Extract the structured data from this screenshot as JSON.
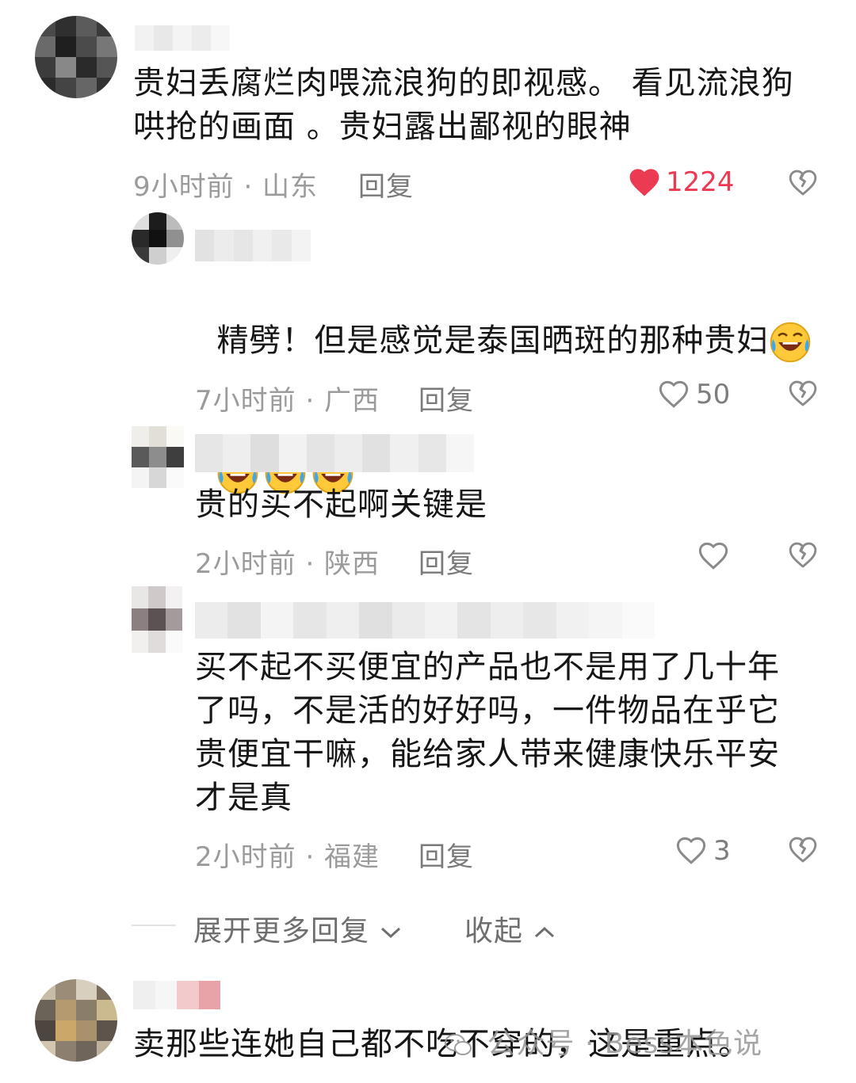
{
  "comments": [
    {
      "text": "贵妇丢腐烂肉喂流浪狗的即视感。 看见流浪狗\n哄抢的画面 。贵妇露出鄙视的眼神",
      "meta": "9小时前 · 山东",
      "reply_label": "回复",
      "likes": "1224",
      "liked": true
    },
    {
      "text": "精劈！但是感觉是泰国晒斑的那种贵妇",
      "emoji_name": "laughing-tears-emoji",
      "meta": "7小时前 · 广西",
      "reply_label": "回复",
      "likes": "50"
    },
    {
      "text": "贵的买不起啊关键是",
      "meta": "2小时前 · 陕西",
      "reply_label": "回复",
      "likes": ""
    },
    {
      "text": "买不起不买便宜的产品也不是用了几十年\n了吗，不是活的好好吗，一件物品在乎它\n贵便宜干嘛，能给家人带来健康快乐平安\n才是真",
      "meta": "2小时前 · 福建",
      "reply_label": "回复",
      "likes": "3"
    },
    {
      "text": "卖那些连她自己都不吃不穿的，这是重点。"
    }
  ],
  "expand_label": "展开更多回复",
  "collapse_label": "收起",
  "watermark": "公众号 · Bess本色说",
  "colors": {
    "liked_red": "#ec3a53",
    "meta_gray": "#9b9b9b",
    "text_dark": "#161616"
  },
  "icons": [
    "heart-filled-icon",
    "heart-outline-icon",
    "broken-heart-icon",
    "chevron-down-icon",
    "chevron-up-icon",
    "wechat-logo-icon"
  ]
}
